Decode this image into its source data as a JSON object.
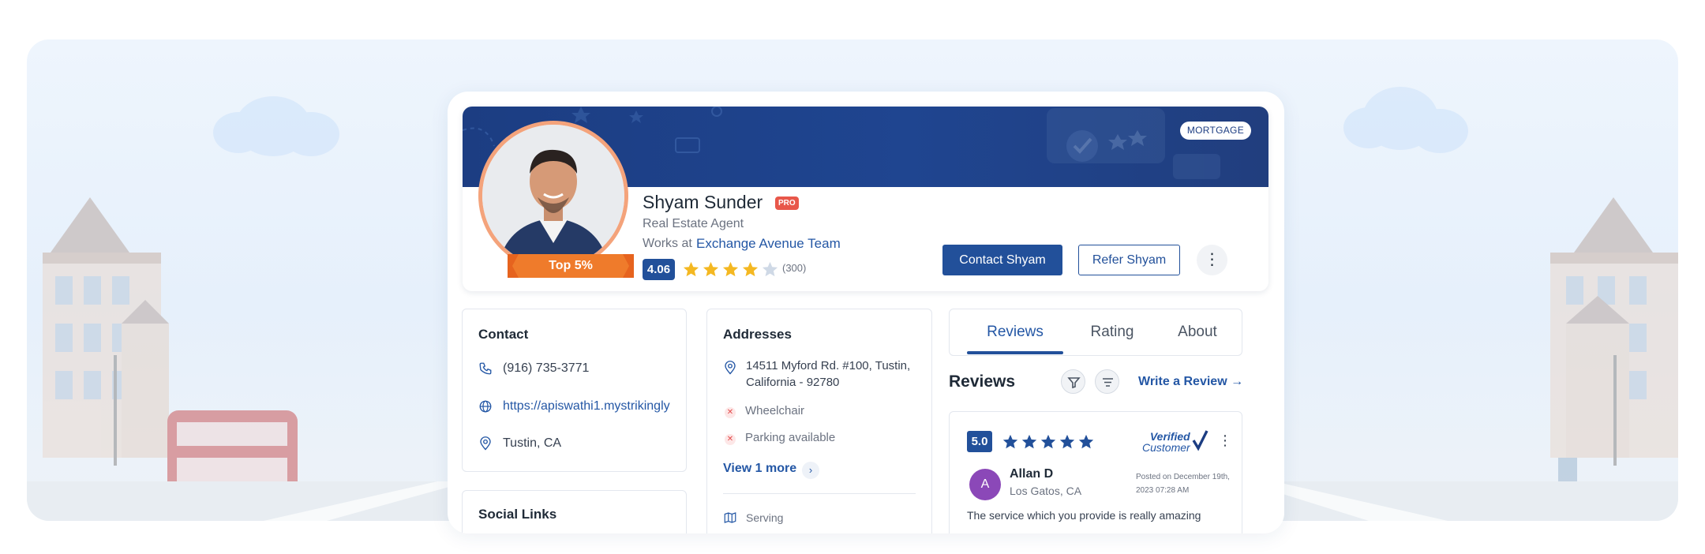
{
  "colors": {
    "primary": "#22509a",
    "banner": "#1c3d82",
    "pro": "#e8574a",
    "star": "#f4b822",
    "ribbon": "#f07a2e",
    "reviewStar": "#22509a"
  },
  "profile": {
    "category_badge": "MORTGAGE",
    "name": "Shyam Sunder",
    "pro_label": "PRO",
    "role": "Real Estate Agent",
    "works_at_label": "Works at",
    "company": "Exchange Avenue Team",
    "rating": "4.06",
    "rating_stars": 4,
    "review_count": "(300)",
    "top_label": "Top 5%",
    "contact_button": "Contact Shyam",
    "refer_button": "Refer Shyam",
    "more_icon": "kebab-icon"
  },
  "contact": {
    "title": "Contact",
    "phone": "(916) 735-3771",
    "website": "https://apiswathi1.mystrikingly",
    "location": "Tustin, CA"
  },
  "social": {
    "title": "Social Links"
  },
  "addresses": {
    "title": "Addresses",
    "address": "14511 Myford Rd. #100, Tustin, California - 92780",
    "amenities": [
      "Wheelchair",
      "Parking available"
    ],
    "view_more": "View 1 more",
    "serving_label": "Serving"
  },
  "tabs": [
    "Reviews",
    "Rating",
    "About"
  ],
  "active_tab": "Reviews",
  "reviews": {
    "heading": "Reviews",
    "write_review": "Write a Review",
    "items": [
      {
        "score": "5.0",
        "stars": 5,
        "verified_line1": "Verified",
        "verified_line2": "Customer",
        "avatar_letter": "A",
        "name": "Allan D",
        "location": "Los Gatos, CA",
        "posted": "Posted on December 19th, 2023 07:28 AM",
        "text": "The service which you provide is really amazing"
      }
    ]
  }
}
